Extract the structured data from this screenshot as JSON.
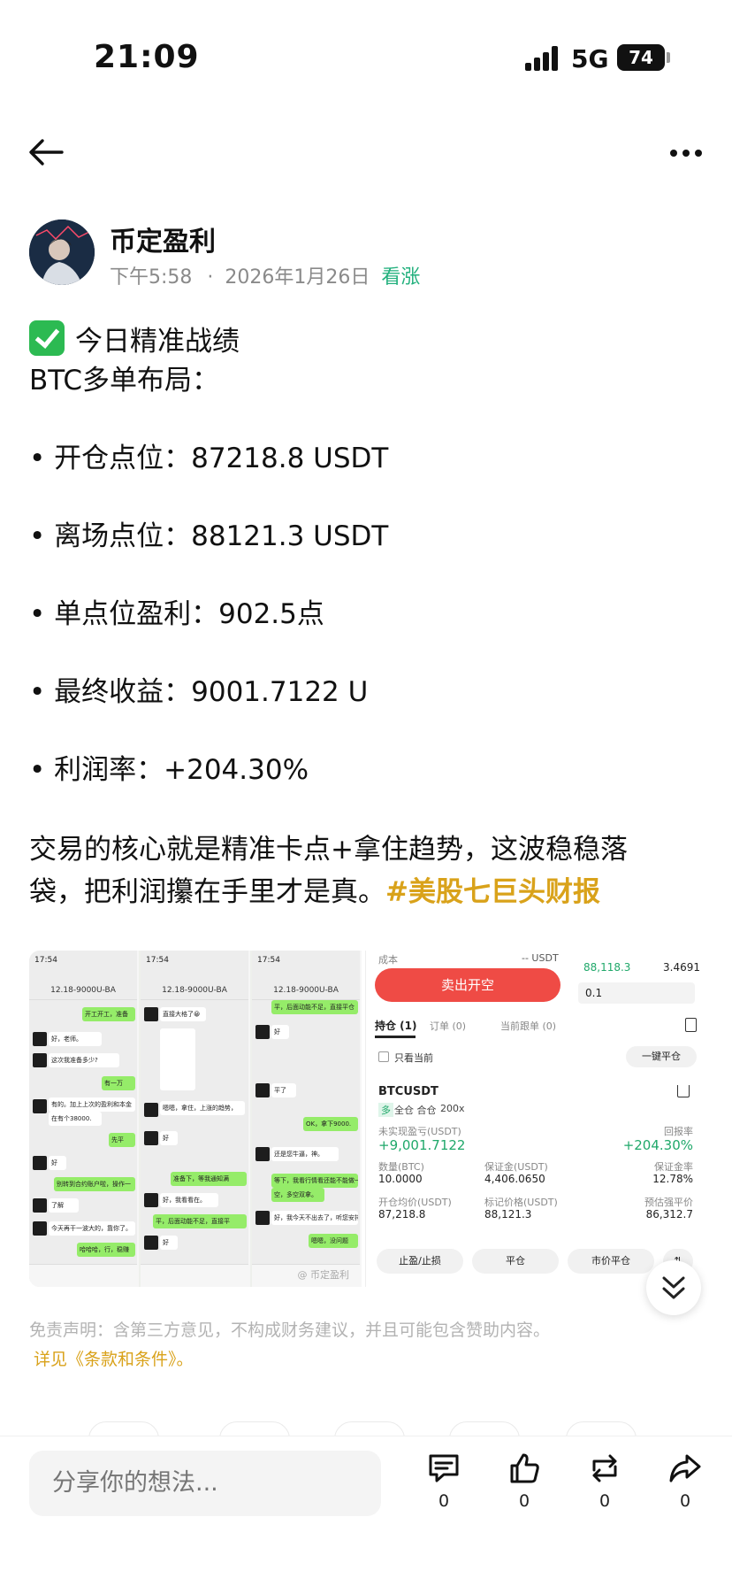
{
  "status_bar": {
    "time": "21:09",
    "network": "5G",
    "battery": "74"
  },
  "author": {
    "name": "币定盈利",
    "time": "下午5:58",
    "separator": "·",
    "date": "2026年1月26日",
    "sentiment": "看涨"
  },
  "post": {
    "headline": "今日精准战绩",
    "subhead": "BTC多单布局：",
    "bullets": [
      "• 开仓点位：87218.8 USDT",
      "• 离场点位：88121.3 USDT",
      "• 单点位盈利：902.5点",
      "• 最终收益：9001.7122 U",
      "• 利润率：+204.30%"
    ],
    "paragraph_line1": "交易的核心就是精准卡点+拿住趋势，这波稳稳落",
    "paragraph_line2": "袋，把利润攥在手里才是真。",
    "hashtag": "#美股七巨头财报"
  },
  "chat_screenshots": {
    "status_time": "17:54",
    "title": "12.18-9000U-BA",
    "watermark": "@ 币定盈利",
    "col1": [
      "开工开工，准备",
      "好，老师。",
      "这次我准备多少?",
      "有一万",
      "有的。加上上次的盈利和本金",
      "在有个38000.",
      "先平",
      "好",
      "别转到合约账户啦，操作一",
      "了解",
      "今天再干一波大的，靠你了。",
      "哈哈哈，行，稳赚"
    ],
    "col2": [
      "直接大格了😀",
      "嗯嗯，拿住，上涨的趋势，",
      "好",
      "准备下，等我通知满",
      "好，我看看在。",
      "平，后面动能不足，直接平",
      "好"
    ],
    "col3": [
      "平，后面动能不足，直接平仓",
      "好",
      "平了",
      "OK，拿下9000.",
      "还是您牛逼，神。",
      "等下，我看行情看还能不能做一",
      "空，多空双拿。",
      "好，我今天不出去了，听您安排",
      "嗯嗯，没问题"
    ]
  },
  "trade_screenshot": {
    "cost_label": "成本",
    "cost_value": "-- USDT",
    "ob_price": "88,118.3",
    "ob_qty": "3.4691",
    "qty_input": "0.1",
    "sell_button": "卖出开空",
    "tab_positions": "持仓 (1)",
    "tab_orders": "订单 (0)",
    "tab_copy": "当前跟单 (0)",
    "only_current": "只看当前",
    "close_all": "一键平仓",
    "symbol": "BTCUSDT",
    "side": "多",
    "margin_mode": "全仓 合仓",
    "leverage": "200x",
    "upnl_label": "未实现盈亏(USDT)",
    "upnl_value": "+9,001.7122",
    "roe_label": "回报率",
    "roe_value": "+204.30%",
    "size_label": "数量(BTC)",
    "size_value": "10.0000",
    "margin_label": "保证金(USDT)",
    "margin_value": "4,406.0650",
    "mmr_label": "保证金率",
    "mmr_value": "12.78%",
    "entry_label": "开仓均价(USDT)",
    "entry_value": "87,218.8",
    "mark_label": "标记价格(USDT)",
    "mark_value": "88,121.3",
    "liq_label": "预估强平价",
    "liq_value": "86,312.7",
    "btn_tpsl": "止盈/止损",
    "btn_close": "平仓",
    "btn_market_close": "市价平仓"
  },
  "disclaimer": "免责声明：含第三方意见，不构成财务建议，并且可能包含赞助内容。",
  "terms_link": "详见《条款和条件》。",
  "bottom_bar": {
    "comment_placeholder": "分享你的想法...",
    "comments": "0",
    "likes": "0",
    "reposts": "0",
    "shares": "0"
  },
  "icons": [
    "back-arrow-icon",
    "more-dots-icon",
    "check-icon",
    "chevron-double-down-icon",
    "comment-icon",
    "like-icon",
    "repost-icon",
    "share-icon"
  ],
  "colors": {
    "sentiment": "#22b07d",
    "hashtag": "#d9a21a",
    "sell": "#ef4b45",
    "profit": "#20a86a"
  }
}
